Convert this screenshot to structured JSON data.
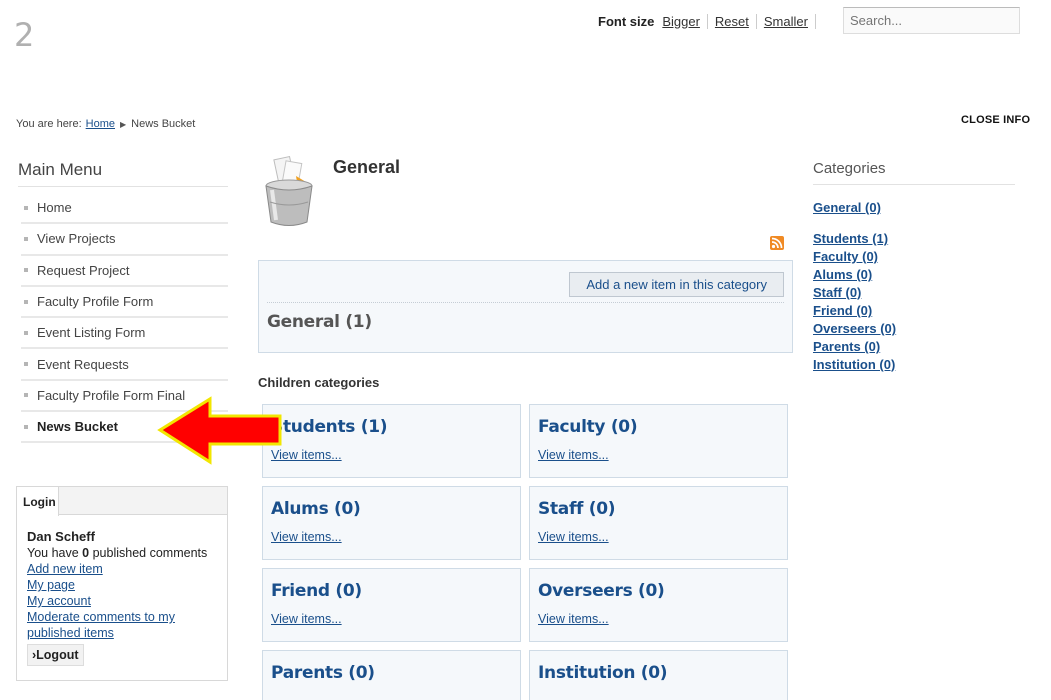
{
  "page_number": "2",
  "font_size": {
    "label": "Font size",
    "bigger": "Bigger",
    "reset": "Reset",
    "smaller": "Smaller"
  },
  "search": {
    "placeholder": "Search..."
  },
  "breadcrumb": {
    "prefix": "You are here:",
    "home": "Home",
    "current": "News Bucket"
  },
  "close_info": "CLOSE INFO",
  "main_menu": {
    "title": "Main Menu",
    "items": [
      {
        "label": "Home"
      },
      {
        "label": "View Projects"
      },
      {
        "label": "Request Project"
      },
      {
        "label": "Faculty Profile Form"
      },
      {
        "label": "Event Listing Form"
      },
      {
        "label": "Event Requests"
      },
      {
        "label": "Faculty Profile Form Final"
      },
      {
        "label": "News Bucket",
        "active": true
      }
    ]
  },
  "login": {
    "tab": "Login",
    "user_name": "Dan Scheff",
    "comments_prefix": "You have",
    "comments_count": "0",
    "comments_suffix": "published comments",
    "links": [
      "Add new item",
      "My page",
      "My account",
      "Moderate comments to my published items"
    ],
    "logout": "›Logout"
  },
  "category": {
    "title": "General",
    "add_item": "Add a new item in this category",
    "items_heading": "General (1)"
  },
  "children": {
    "heading": "Children categories",
    "view_label": "View items...",
    "items": [
      {
        "title": "Students (1)"
      },
      {
        "title": "Faculty (0)"
      },
      {
        "title": "Alums (0)"
      },
      {
        "title": "Staff (0)"
      },
      {
        "title": "Friend (0)"
      },
      {
        "title": "Overseers (0)"
      },
      {
        "title": "Parents (0)"
      },
      {
        "title": "Institution (0)"
      }
    ]
  },
  "categories_sidebar": {
    "title": "Categories",
    "top": "General  (0)",
    "items": [
      "Students  (1)",
      "Faculty  (0)",
      "Alums  (0)",
      "Staff  (0)",
      "Friend  (0)",
      "Overseers  (0)",
      "Parents  (0)",
      "Institution  (0)"
    ]
  },
  "colors": {
    "link": "#1a4f8b",
    "annotation_arrow": "#ff0000",
    "annotation_outline": "#f2e600"
  },
  "annotation": {
    "icon": "red-arrow-pointing-left"
  }
}
